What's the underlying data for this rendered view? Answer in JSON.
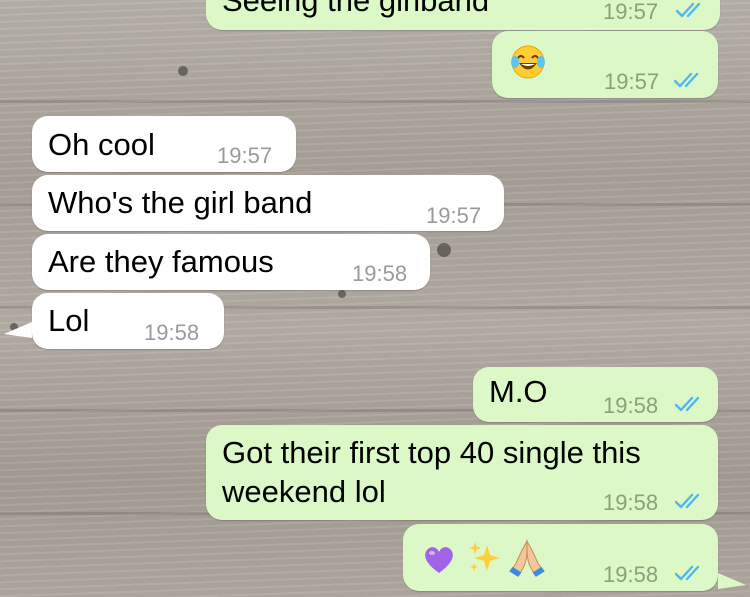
{
  "colors": {
    "incoming_bubble": "#ffffff",
    "outgoing_bubble": "#dcf8c6",
    "read_ticks": "#4fb7f0"
  },
  "messages": [
    {
      "direction": "outgoing",
      "text": "Seeing the girlband",
      "time": "19:57",
      "status": "read"
    },
    {
      "direction": "outgoing",
      "text": "",
      "emoji": [
        "face-with-tears-of-joy"
      ],
      "time": "19:57",
      "status": "read"
    },
    {
      "direction": "incoming",
      "text": "Oh cool",
      "time": "19:57"
    },
    {
      "direction": "incoming",
      "text": "Who's the girl band",
      "time": "19:57"
    },
    {
      "direction": "incoming",
      "text": "Are they famous",
      "time": "19:58"
    },
    {
      "direction": "incoming",
      "text": "Lol",
      "time": "19:58"
    },
    {
      "direction": "outgoing",
      "text": "M.O",
      "time": "19:58",
      "status": "read"
    },
    {
      "direction": "outgoing",
      "text_lines": [
        "Got their first top 40 single this",
        "weekend lol"
      ],
      "time": "19:58",
      "status": "read"
    },
    {
      "direction": "outgoing",
      "text": "",
      "emoji": [
        "purple-heart",
        "sparkles",
        "folded-hands"
      ],
      "time": "19:58",
      "status": "read"
    }
  ]
}
